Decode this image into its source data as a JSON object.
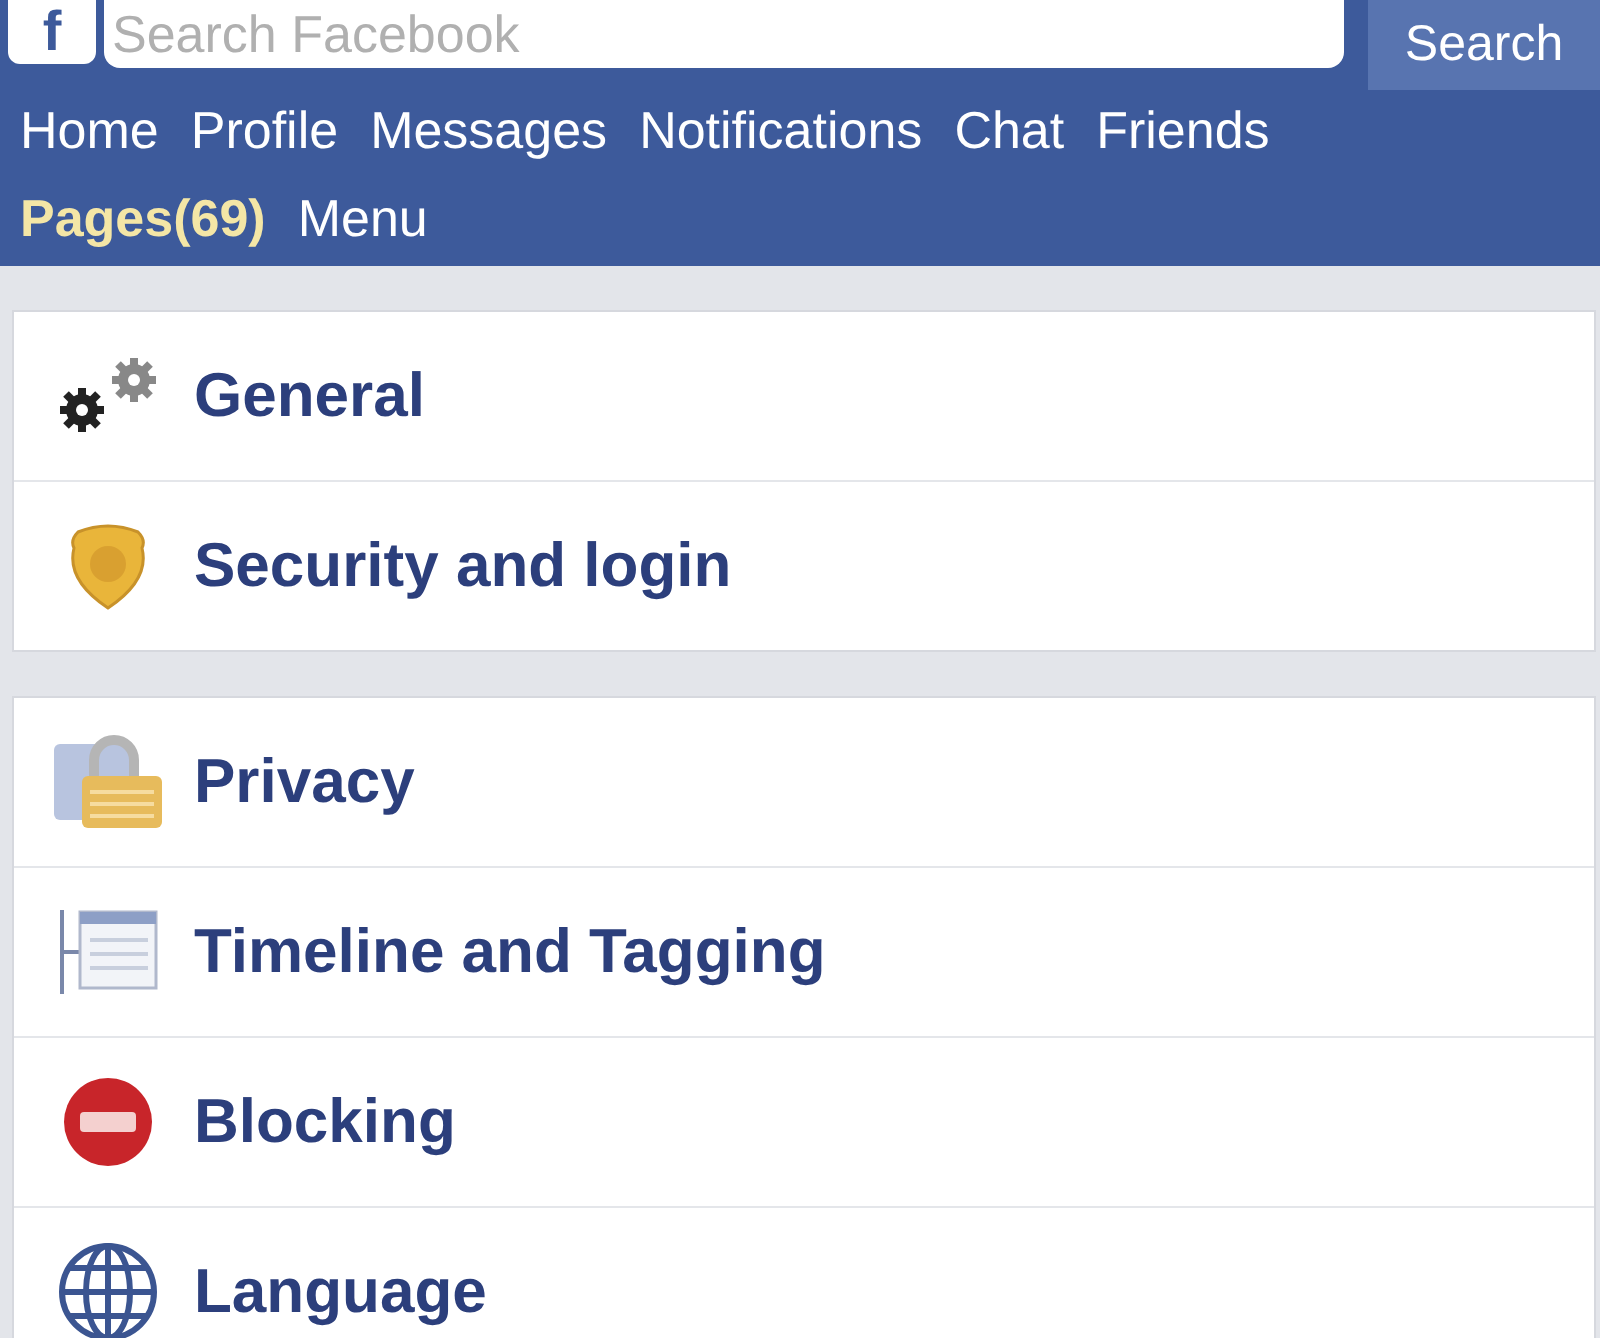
{
  "header": {
    "logo": "f",
    "search": {
      "placeholder": "Search Facebook"
    },
    "search_button": "Search"
  },
  "nav": [
    {
      "label": "Home",
      "selected": false
    },
    {
      "label": "Profile",
      "selected": false
    },
    {
      "label": "Messages",
      "selected": false
    },
    {
      "label": "Notifications",
      "selected": false
    },
    {
      "label": "Chat",
      "selected": false
    },
    {
      "label": "Friends",
      "selected": false
    },
    {
      "label": "Pages(69)",
      "selected": true
    },
    {
      "label": "Menu",
      "selected": false
    }
  ],
  "groups": [
    {
      "items": [
        {
          "label": "General",
          "kind": "gears"
        },
        {
          "label": "Security and login",
          "kind": "badge"
        }
      ]
    },
    {
      "items": [
        {
          "label": "Privacy",
          "kind": "lock"
        },
        {
          "label": "Timeline and Tagging",
          "kind": "timeline"
        },
        {
          "label": "Blocking",
          "kind": "block"
        },
        {
          "label": "Language",
          "kind": "globe"
        }
      ]
    }
  ]
}
